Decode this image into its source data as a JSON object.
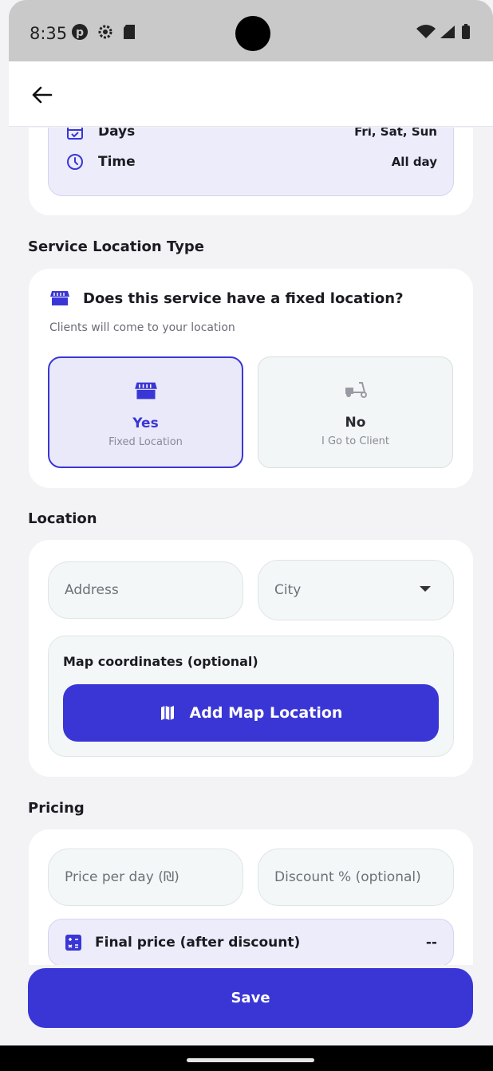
{
  "status_bar": {
    "time": "8:35"
  },
  "schedule": {
    "days_label": "Days",
    "days_value": "Fri, Sat, Sun",
    "time_label": "Time",
    "time_value": "All day"
  },
  "location_type": {
    "section_title": "Service Location Type",
    "question": "Does this service have a fixed location?",
    "subtitle": "Clients will come to your location",
    "options": [
      {
        "title": "Yes",
        "subtitle": "Fixed Location",
        "selected": true
      },
      {
        "title": "No",
        "subtitle": "I Go to Client",
        "selected": false
      }
    ]
  },
  "location": {
    "section_title": "Location",
    "address_placeholder": "Address",
    "city_placeholder": "City",
    "map_label": "Map coordinates (optional)",
    "map_button": "Add Map Location"
  },
  "pricing": {
    "section_title": "Pricing",
    "price_placeholder": "Price per day (₪)",
    "discount_placeholder": "Discount % (optional)",
    "final_label": "Final price (after discount)",
    "final_value": "--"
  },
  "save_label": "Save",
  "colors": {
    "accent": "#3a36d6",
    "accent_light": "#ececfb",
    "background": "#f3f3f6"
  }
}
